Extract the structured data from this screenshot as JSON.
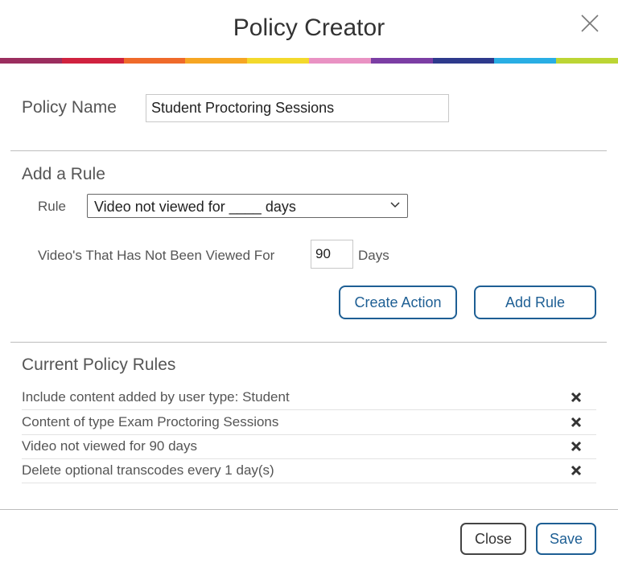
{
  "header": {
    "title": "Policy Creator",
    "close_icon": "close-icon",
    "rainbow_colors": [
      "#9b2e5f",
      "#d0223f",
      "#ef6a2a",
      "#f6a623",
      "#f3d92c",
      "#e992c3",
      "#7b3ea4",
      "#2e3a8c",
      "#29aee4",
      "#bcd534"
    ]
  },
  "policy_name": {
    "label": "Policy Name",
    "value": "Student Proctoring Sessions"
  },
  "add_rule": {
    "heading": "Add a Rule",
    "rule_label": "Rule",
    "rule_selected": "Video not viewed for ____ days",
    "days_prefix": "Video's That Has Not Been Viewed For",
    "days_value": "90",
    "days_suffix": "Days",
    "create_action_label": "Create Action",
    "add_rule_label": "Add Rule"
  },
  "current_rules": {
    "heading": "Current Policy Rules",
    "items": [
      {
        "text": "Include content added by user type: Student"
      },
      {
        "text": "Content of type Exam Proctoring Sessions"
      },
      {
        "text": "Video not viewed for 90 days"
      },
      {
        "text": "Delete optional transcodes every 1 day(s)"
      }
    ]
  },
  "footer": {
    "close_label": "Close",
    "save_label": "Save"
  },
  "colors": {
    "accent": "#1e5f94"
  }
}
